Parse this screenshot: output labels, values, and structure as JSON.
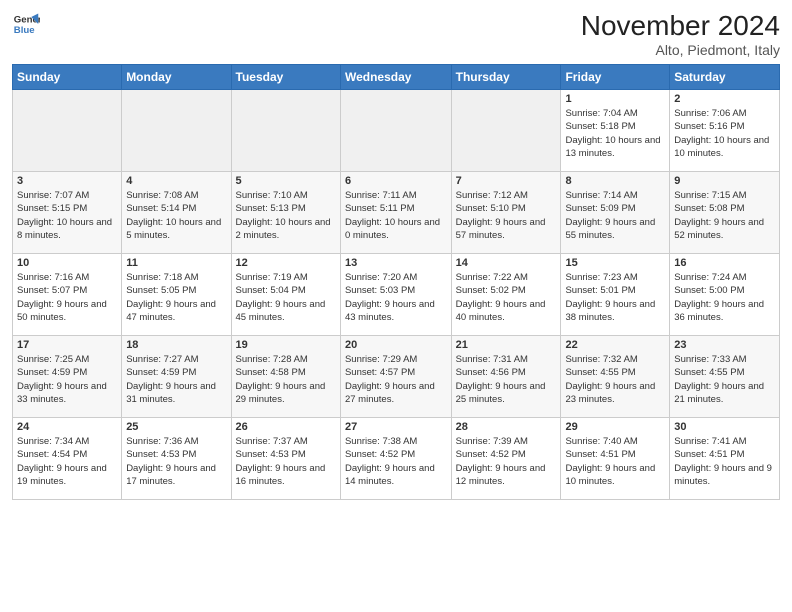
{
  "header": {
    "logo_line1": "General",
    "logo_line2": "Blue",
    "month_title": "November 2024",
    "location": "Alto, Piedmont, Italy"
  },
  "weekdays": [
    "Sunday",
    "Monday",
    "Tuesday",
    "Wednesday",
    "Thursday",
    "Friday",
    "Saturday"
  ],
  "weeks": [
    [
      {
        "day": "",
        "info": ""
      },
      {
        "day": "",
        "info": ""
      },
      {
        "day": "",
        "info": ""
      },
      {
        "day": "",
        "info": ""
      },
      {
        "day": "",
        "info": ""
      },
      {
        "day": "1",
        "info": "Sunrise: 7:04 AM\nSunset: 5:18 PM\nDaylight: 10 hours and 13 minutes."
      },
      {
        "day": "2",
        "info": "Sunrise: 7:06 AM\nSunset: 5:16 PM\nDaylight: 10 hours and 10 minutes."
      }
    ],
    [
      {
        "day": "3",
        "info": "Sunrise: 7:07 AM\nSunset: 5:15 PM\nDaylight: 10 hours and 8 minutes."
      },
      {
        "day": "4",
        "info": "Sunrise: 7:08 AM\nSunset: 5:14 PM\nDaylight: 10 hours and 5 minutes."
      },
      {
        "day": "5",
        "info": "Sunrise: 7:10 AM\nSunset: 5:13 PM\nDaylight: 10 hours and 2 minutes."
      },
      {
        "day": "6",
        "info": "Sunrise: 7:11 AM\nSunset: 5:11 PM\nDaylight: 10 hours and 0 minutes."
      },
      {
        "day": "7",
        "info": "Sunrise: 7:12 AM\nSunset: 5:10 PM\nDaylight: 9 hours and 57 minutes."
      },
      {
        "day": "8",
        "info": "Sunrise: 7:14 AM\nSunset: 5:09 PM\nDaylight: 9 hours and 55 minutes."
      },
      {
        "day": "9",
        "info": "Sunrise: 7:15 AM\nSunset: 5:08 PM\nDaylight: 9 hours and 52 minutes."
      }
    ],
    [
      {
        "day": "10",
        "info": "Sunrise: 7:16 AM\nSunset: 5:07 PM\nDaylight: 9 hours and 50 minutes."
      },
      {
        "day": "11",
        "info": "Sunrise: 7:18 AM\nSunset: 5:05 PM\nDaylight: 9 hours and 47 minutes."
      },
      {
        "day": "12",
        "info": "Sunrise: 7:19 AM\nSunset: 5:04 PM\nDaylight: 9 hours and 45 minutes."
      },
      {
        "day": "13",
        "info": "Sunrise: 7:20 AM\nSunset: 5:03 PM\nDaylight: 9 hours and 43 minutes."
      },
      {
        "day": "14",
        "info": "Sunrise: 7:22 AM\nSunset: 5:02 PM\nDaylight: 9 hours and 40 minutes."
      },
      {
        "day": "15",
        "info": "Sunrise: 7:23 AM\nSunset: 5:01 PM\nDaylight: 9 hours and 38 minutes."
      },
      {
        "day": "16",
        "info": "Sunrise: 7:24 AM\nSunset: 5:00 PM\nDaylight: 9 hours and 36 minutes."
      }
    ],
    [
      {
        "day": "17",
        "info": "Sunrise: 7:25 AM\nSunset: 4:59 PM\nDaylight: 9 hours and 33 minutes."
      },
      {
        "day": "18",
        "info": "Sunrise: 7:27 AM\nSunset: 4:59 PM\nDaylight: 9 hours and 31 minutes."
      },
      {
        "day": "19",
        "info": "Sunrise: 7:28 AM\nSunset: 4:58 PM\nDaylight: 9 hours and 29 minutes."
      },
      {
        "day": "20",
        "info": "Sunrise: 7:29 AM\nSunset: 4:57 PM\nDaylight: 9 hours and 27 minutes."
      },
      {
        "day": "21",
        "info": "Sunrise: 7:31 AM\nSunset: 4:56 PM\nDaylight: 9 hours and 25 minutes."
      },
      {
        "day": "22",
        "info": "Sunrise: 7:32 AM\nSunset: 4:55 PM\nDaylight: 9 hours and 23 minutes."
      },
      {
        "day": "23",
        "info": "Sunrise: 7:33 AM\nSunset: 4:55 PM\nDaylight: 9 hours and 21 minutes."
      }
    ],
    [
      {
        "day": "24",
        "info": "Sunrise: 7:34 AM\nSunset: 4:54 PM\nDaylight: 9 hours and 19 minutes."
      },
      {
        "day": "25",
        "info": "Sunrise: 7:36 AM\nSunset: 4:53 PM\nDaylight: 9 hours and 17 minutes."
      },
      {
        "day": "26",
        "info": "Sunrise: 7:37 AM\nSunset: 4:53 PM\nDaylight: 9 hours and 16 minutes."
      },
      {
        "day": "27",
        "info": "Sunrise: 7:38 AM\nSunset: 4:52 PM\nDaylight: 9 hours and 14 minutes."
      },
      {
        "day": "28",
        "info": "Sunrise: 7:39 AM\nSunset: 4:52 PM\nDaylight: 9 hours and 12 minutes."
      },
      {
        "day": "29",
        "info": "Sunrise: 7:40 AM\nSunset: 4:51 PM\nDaylight: 9 hours and 10 minutes."
      },
      {
        "day": "30",
        "info": "Sunrise: 7:41 AM\nSunset: 4:51 PM\nDaylight: 9 hours and 9 minutes."
      }
    ]
  ]
}
